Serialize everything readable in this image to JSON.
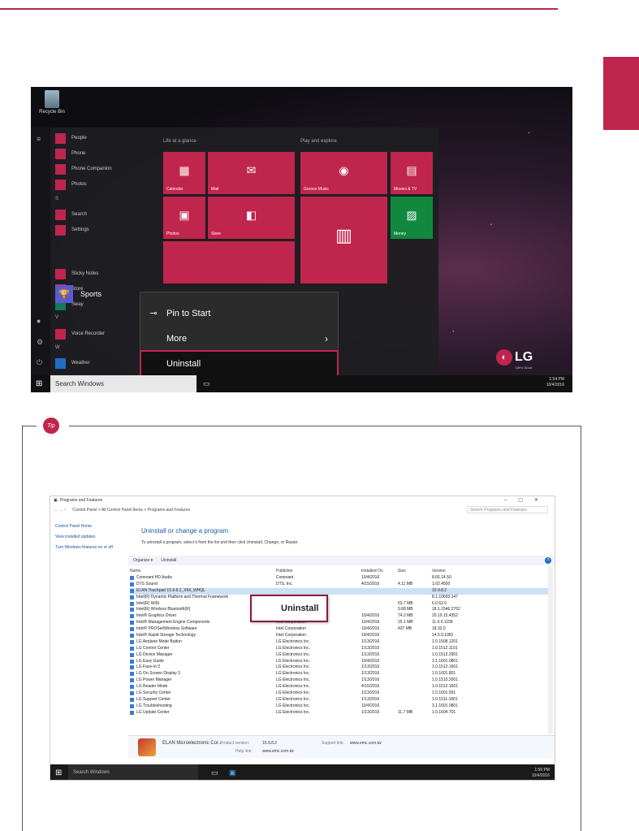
{
  "start_menu": {
    "recycle_bin": "Recycle Bin",
    "apps": [
      "People",
      "Phone",
      "Phone Companion",
      "Photos"
    ],
    "section_s": "S",
    "apps_s": [
      "Search",
      "Settings"
    ],
    "selected_app": "Sports",
    "apps_after": [
      "Sticky Notes",
      "Store",
      "Sway"
    ],
    "section_v": "V",
    "apps_v": [
      "Voice Recorder"
    ],
    "section_w": "W",
    "apps_w": [
      "Weather"
    ],
    "group1_title": "Life at a glance",
    "group2_title": "Play and explore",
    "tiles": {
      "calendar": "Calendar",
      "mail": "Mail",
      "groove": "Groove Music",
      "movies": "Movies & TV",
      "photos": "Photos",
      "store": "Store",
      "money": "Money"
    }
  },
  "context_menu": {
    "pin": "Pin to Start",
    "more": "More",
    "uninstall": "Uninstall"
  },
  "taskbar1": {
    "search": "Search Windows",
    "time": "1:54 PM",
    "date": "10/4/2016"
  },
  "brand": {
    "logo": "LG",
    "tagline": "Life's Good"
  },
  "tip": {
    "badge": "Tip"
  },
  "programs": {
    "window_title": "Programs and Features",
    "breadcrumb": "Control Panel  >  All Control Panel Items  >  Programs and Features",
    "search_placeholder": "Search Programs and Features",
    "left_links": [
      "Control Panel Home",
      "View installed updates",
      "Turn Windows features on or off"
    ],
    "heading": "Uninstall or change a program",
    "description": "To uninstall a program, select it from the list and then click Uninstall, Change, or Repair.",
    "organize": "Organize ▾",
    "uninstall_cmd": "Uninstall",
    "columns": {
      "name": "Name",
      "publisher": "Publisher",
      "installed": "Installed On",
      "size": "Size",
      "version": "Version"
    },
    "rows": [
      {
        "name": "Conexant HD Audio",
        "publisher": "Conexant",
        "date": "10/4/2016",
        "size": "",
        "version": "8.66.14.50"
      },
      {
        "name": "DTS Sound",
        "publisher": "DTS, Inc.",
        "date": "4/15/2016",
        "size": "4.11 MB",
        "version": "1.02.4500"
      },
      {
        "name": "ELAN Touchpad 15.9.8.2_X64_WHQL",
        "publisher": "",
        "date": "",
        "size": "",
        "version": "15.9.8.2"
      },
      {
        "name": "Intel(R) Dynamic Platform and Thermal Framework",
        "publisher": "",
        "date": "",
        "size": "",
        "version": "8.1.10600.147"
      },
      {
        "name": "Intel(R) WiDi",
        "publisher": "",
        "date": "",
        "size": "53.7 MB",
        "version": "6.0.52.0"
      },
      {
        "name": "Intel(R) Wireless Bluetooth(R)",
        "publisher": "",
        "date": "",
        "size": "9.68 MB",
        "version": "18.1.1546.2762"
      },
      {
        "name": "Intel® Graphics Driver",
        "publisher": "Intel Corporation",
        "date": "10/4/2016",
        "size": "74.2 MB",
        "version": "20.19.15.4352"
      },
      {
        "name": "Intel® Management Engine Components",
        "publisher": "Intel Corporation",
        "date": "10/4/2016",
        "size": "15.1 MB",
        "version": "11.0.0.1158"
      },
      {
        "name": "Intel® PROSet/Wireless Software",
        "publisher": "Intel Corporation",
        "date": "10/4/2016",
        "size": "437 MB",
        "version": "18.32.0"
      },
      {
        "name": "Intel® Rapid Storage Technology",
        "publisher": "Intel Corporation",
        "date": "10/4/2016",
        "size": "",
        "version": "14.5.0.1081"
      },
      {
        "name": "LG Airplane Mode Button",
        "publisher": "LG Electronics Inc.",
        "date": "1/13/2016",
        "size": "",
        "version": "1.0.1508.1201"
      },
      {
        "name": "LG Control Center",
        "publisher": "LG Electronics Inc.",
        "date": "1/13/2016",
        "size": "",
        "version": "1.0.1512.1101"
      },
      {
        "name": "LG Device Manager",
        "publisher": "LG Electronics Inc.",
        "date": "1/13/2016",
        "size": "",
        "version": "1.0.1512.2901"
      },
      {
        "name": "LG Easy Guide",
        "publisher": "LG Electronics Inc.",
        "date": "10/4/2016",
        "size": "",
        "version": "3.1.1601.0801"
      },
      {
        "name": "LG Face-In 2",
        "publisher": "LG Electronics Inc.",
        "date": "1/13/2016",
        "size": "",
        "version": "1.0.1512.1601"
      },
      {
        "name": "LG On Screen Display 3",
        "publisher": "LG Electronics Inc.",
        "date": "1/13/2016",
        "size": "",
        "version": "1.0.1601.801"
      },
      {
        "name": "LG Power Manager",
        "publisher": "LG Electronics Inc.",
        "date": "1/13/2016",
        "size": "",
        "version": "1.0.1510.2001"
      },
      {
        "name": "LG Reader Mode",
        "publisher": "LG Electronics Inc.",
        "date": "4/15/2016",
        "size": "",
        "version": "1.0.1512.1601"
      },
      {
        "name": "LG Security Center",
        "publisher": "LG Electronics Inc.",
        "date": "1/13/2016",
        "size": "",
        "version": "1.0.1601.501"
      },
      {
        "name": "LG Support Center",
        "publisher": "LG Electronics Inc.",
        "date": "1/13/2016",
        "size": "",
        "version": "1.0.1511.1801"
      },
      {
        "name": "LG Troubleshooting",
        "publisher": "LG Electronics Inc.",
        "date": "10/4/2016",
        "size": "",
        "version": "3.1.1601.0801"
      },
      {
        "name": "LG Update Center",
        "publisher": "LG Electronics Inc.",
        "date": "1/13/2016",
        "size": "11.7 MB",
        "version": "1.0.1604.701"
      }
    ],
    "popup_uninstall": "Uninstall",
    "details": {
      "name": "ELAN Microelectronic Cor...",
      "pv_label": "Product version:",
      "pv": "15.9.8.2",
      "sl_label": "Support link:",
      "sl": "www.emc.com.tw",
      "hl_label": "Help link:",
      "hl": "www.emc.com.tw"
    }
  },
  "taskbar2": {
    "search": "Search Windows",
    "time": "1:56 PM",
    "date": "10/4/2016"
  }
}
